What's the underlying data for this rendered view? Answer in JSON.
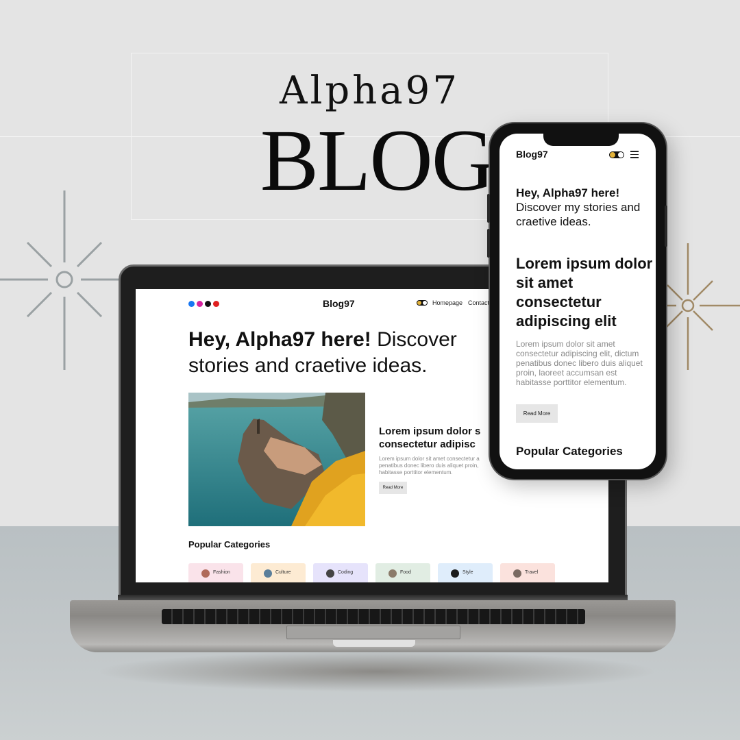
{
  "poster": {
    "title_small": "Alpha97",
    "title_big": "BLOG"
  },
  "laptop": {
    "brand": "Blog97",
    "nav": [
      "Homepage",
      "Contact"
    ],
    "hero_bold": "Hey, Alpha97 here!",
    "hero_rest_line1": " Discover",
    "hero_line2": "stories and craetive ideas.",
    "post_title_line1": "Lorem ipsum dolor s",
    "post_title_line2": "consectetur adipisc",
    "post_body": [
      "Lorem ipsum dolor sit amet consectetur a",
      "penatibus donec libero duis aliquet proin,",
      "habitasse porttitor elementum."
    ],
    "read_more": "Read More",
    "popular_title": "Popular Categories",
    "categories": [
      {
        "label": "Fashion",
        "bg": "#fae3ea"
      },
      {
        "label": "Culture",
        "bg": "#fdebd3"
      },
      {
        "label": "Coding",
        "bg": "#e6e3fb"
      },
      {
        "label": "Food",
        "bg": "#e1ede3"
      },
      {
        "label": "Style",
        "bg": "#dfedfb"
      },
      {
        "label": "Travel",
        "bg": "#fbe2dd"
      }
    ]
  },
  "phone": {
    "brand": "Blog97",
    "hero_bold": "Hey, Alpha97 here!",
    "hero_rest": "Discover my stories and craetive ideas.",
    "post_title": "Lorem ipsum dolor sit amet consectetur adipiscing elit",
    "post_body": "Lorem ipsum dolor sit amet consectetur adipiscing elit, dictum penatibus donec libero duis aliquet proin, laoreet accumsan est habitasse porttitor elementum.",
    "read_more": "Read More",
    "popular_title": "Popular Categories"
  }
}
